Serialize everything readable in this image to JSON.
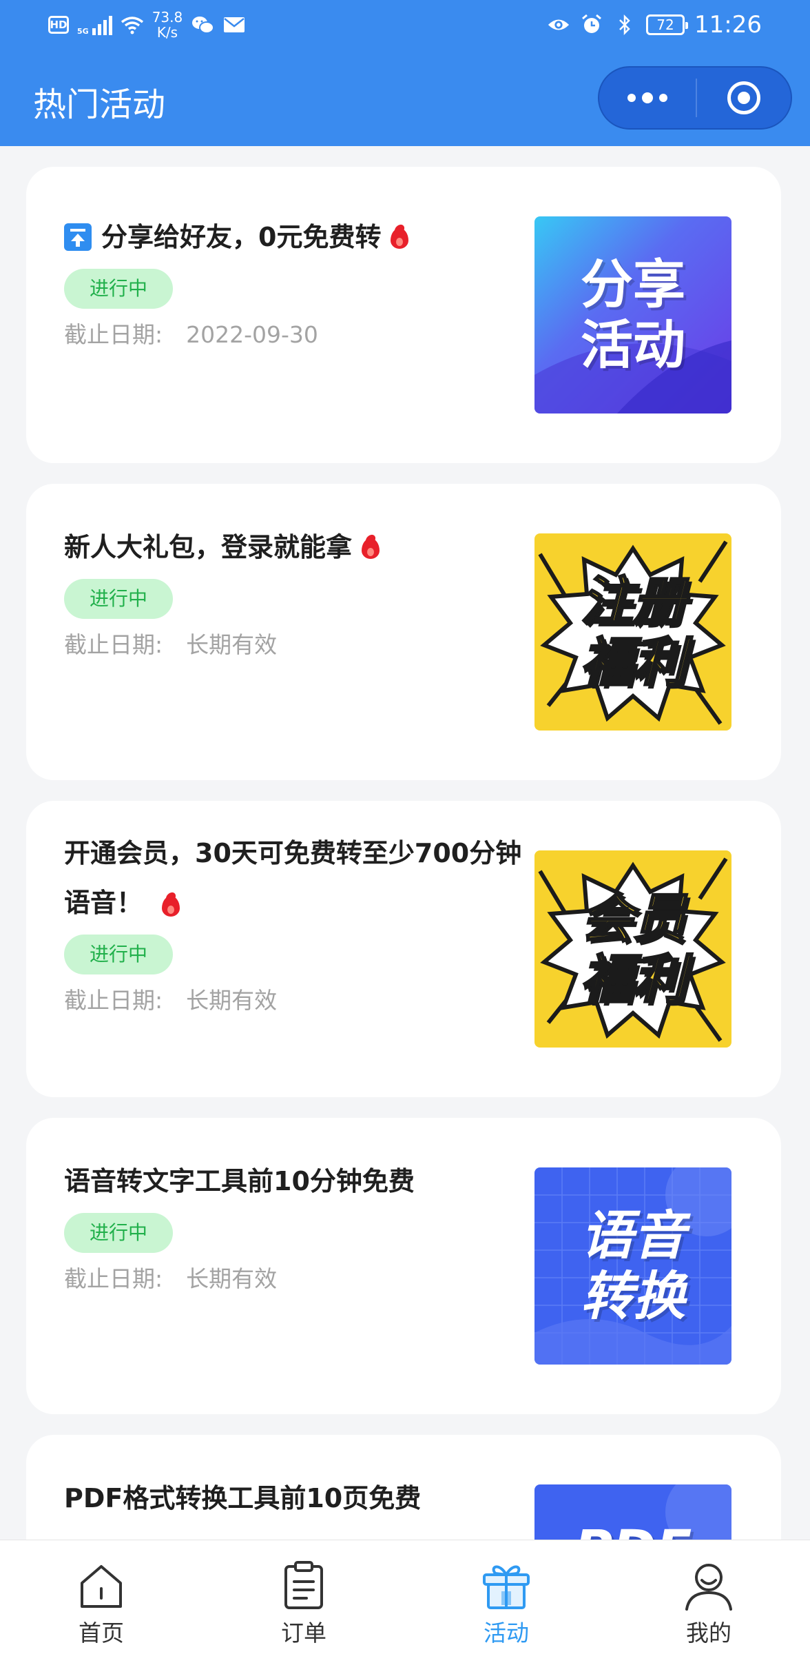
{
  "status_bar": {
    "net_speed_value": "73.8",
    "net_speed_unit": "K/s",
    "hd": "HD",
    "sig": "5G",
    "battery": "72",
    "time": "11:26"
  },
  "header": {
    "title": "热门活动"
  },
  "activities": [
    {
      "title": "分享给好友，0元免费转",
      "status": "进行中",
      "deadline_label": "截止日期:",
      "deadline": "2022-09-30",
      "thumb_text": [
        "分享",
        "活动"
      ]
    },
    {
      "title": "新人大礼包，登录就能拿",
      "status": "进行中",
      "deadline_label": "截止日期:",
      "deadline": "长期有效",
      "thumb_text": [
        "注册",
        "福利"
      ]
    },
    {
      "title": "开通会员，30天可免费转至少700分钟语音！",
      "status": "进行中",
      "deadline_label": "截止日期:",
      "deadline": "长期有效",
      "thumb_text": [
        "会员",
        "福利"
      ]
    },
    {
      "title": "语音转文字工具前10分钟免费",
      "status": "进行中",
      "deadline_label": "截止日期:",
      "deadline": "长期有效",
      "thumb_text": [
        "语音",
        "转换"
      ]
    },
    {
      "title": "PDF格式转换工具前10页免费",
      "thumb_text": [
        "PDF"
      ]
    }
  ],
  "tabbar": [
    {
      "label": "首页",
      "icon": "home-icon",
      "active": false
    },
    {
      "label": "订单",
      "icon": "clipboard-icon",
      "active": false
    },
    {
      "label": "活动",
      "icon": "gift-icon",
      "active": true
    },
    {
      "label": "我的",
      "icon": "user-icon",
      "active": false
    }
  ],
  "colors": {
    "header_bg": "#3a8bef",
    "active_tab": "#2f9af2",
    "badge_bg": "#c9f5d2",
    "badge_text": "#21b04b",
    "flame": "#e8202a"
  }
}
